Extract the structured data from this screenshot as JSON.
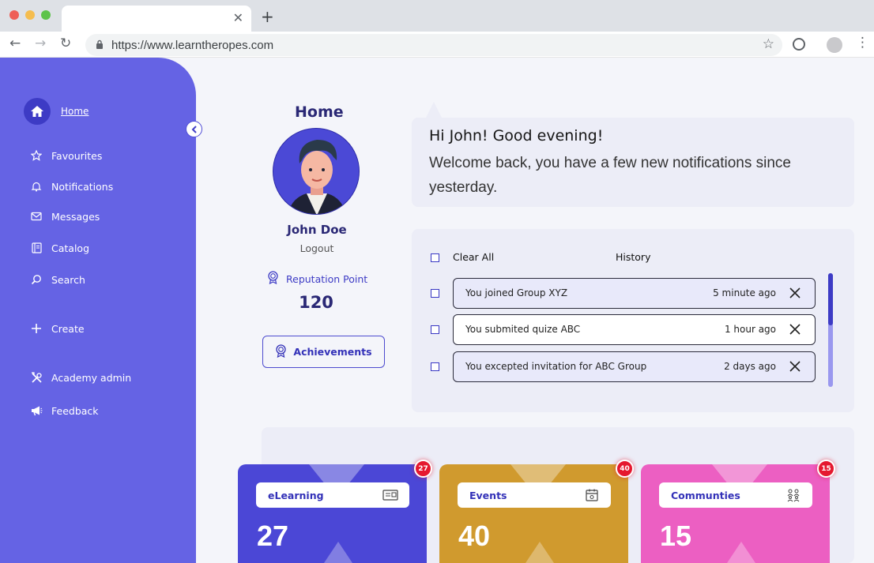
{
  "browser": {
    "url": "https://www.learntheropes.com"
  },
  "sidebar": {
    "home_label": "Home",
    "items": [
      {
        "label": "Favourites",
        "icon": "star-icon"
      },
      {
        "label": "Notifications",
        "icon": "bell-icon"
      },
      {
        "label": "Messages",
        "icon": "mail-icon"
      },
      {
        "label": "Catalog",
        "icon": "book-icon"
      },
      {
        "label": "Search",
        "icon": "search-icon"
      },
      {
        "label": "Create",
        "icon": "plus-icon"
      },
      {
        "label": "Academy admin",
        "icon": "tools-icon"
      },
      {
        "label": "Feedback",
        "icon": "megaphone-icon"
      }
    ]
  },
  "profile": {
    "page_title": "Home",
    "name": "John Doe",
    "logout": "Logout",
    "reputation_label": "Reputation Point",
    "reputation_value": "120",
    "achievements_label": "Achievements"
  },
  "greeting": {
    "line1": "Hi John! Good evening!",
    "line2": "Welcome back, you have a few new notifications since yesterday."
  },
  "notifications": {
    "clear_all": "Clear All",
    "history": "History",
    "items": [
      {
        "text": "You joined Group XYZ",
        "time": "5 minute ago"
      },
      {
        "text": "You submited quize ABC",
        "time": "1 hour ago"
      },
      {
        "text": "You excepted invitation for ABC Group",
        "time": "2 days ago"
      }
    ]
  },
  "stats": [
    {
      "label": "eLearning",
      "value": "27",
      "badge": "27",
      "color": "#4b47d6",
      "label_color": "#3331b8",
      "icon": "elearning-icon"
    },
    {
      "label": "Events",
      "value": "40",
      "badge": "40",
      "color": "#d09a2e",
      "label_color": "#3331b8",
      "icon": "calendar-icon"
    },
    {
      "label": "Communties",
      "value": "15",
      "badge": "15",
      "color": "#ec5fc2",
      "label_color": "#3331b8",
      "icon": "community-icon"
    }
  ],
  "colors": {
    "sidebar": "#6563e4",
    "accent": "#3d3bc5",
    "badge": "#e5182f"
  }
}
